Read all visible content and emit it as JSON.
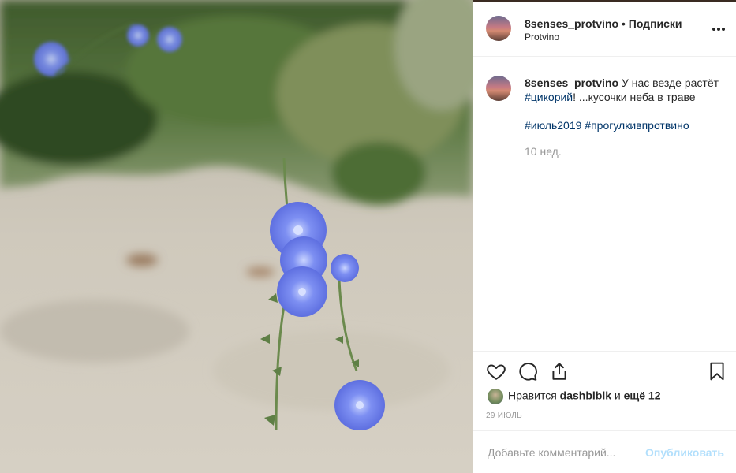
{
  "post": {
    "photo_alt": "blue chicory flowers growing out of sand",
    "header": {
      "username": "8senses_protvino",
      "separator": "•",
      "follow_label": "Подписки",
      "location": "Protvino",
      "more_icon": "more-horizontal-icon"
    },
    "caption": {
      "username": "8senses_protvino",
      "text_before": "У нас везде растёт",
      "hashtag1": "#цикорий",
      "text_after": "! ...кусочки неба в траве",
      "divider": "___",
      "hashtag2": "#июль2019",
      "hashtag3": "#прогулкивпротвино",
      "time_ago": "10 нед."
    },
    "actions": {
      "like_icon": "heart-icon",
      "comment_icon": "comment-icon",
      "share_icon": "share-icon",
      "save_icon": "bookmark-icon"
    },
    "likes": {
      "prefix": "Нравится",
      "user": "dashblblk",
      "middle": "и",
      "others": "ещё 12"
    },
    "date": "29 ИЮЛЬ",
    "comment": {
      "placeholder": "Добавьте комментарий...",
      "publish_label": "Опубликовать"
    }
  },
  "colors": {
    "link": "#003569",
    "publish_disabled": "#b2dffc",
    "muted": "#999999",
    "text": "#262626"
  }
}
